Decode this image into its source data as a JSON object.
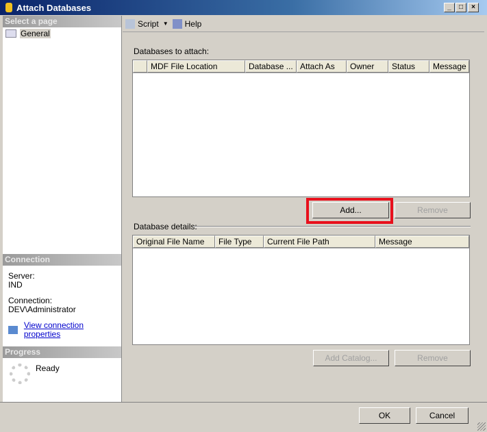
{
  "window": {
    "title": "Attach Databases"
  },
  "left": {
    "select_page": "Select a page",
    "pages": [
      "General"
    ],
    "connection_header": "Connection",
    "server_label": "Server:",
    "server": "IND",
    "connection_label": "Connection:",
    "connection": "DEV\\Administrator",
    "view_props": "View connection properties",
    "progress_header": "Progress",
    "progress_status": "Ready"
  },
  "toolbar": {
    "script": "Script",
    "help": "Help"
  },
  "attach": {
    "label": "Databases to attach:",
    "columns": [
      "",
      "MDF File Location",
      "Database ...",
      "Attach As",
      "Owner",
      "Status",
      "Message"
    ],
    "add": "Add...",
    "remove": "Remove"
  },
  "details": {
    "label": "Database details:",
    "columns": [
      "Original File Name",
      "File Type",
      "Current File Path",
      "Message"
    ],
    "add_catalog": "Add Catalog...",
    "remove": "Remove"
  },
  "footer": {
    "ok": "OK",
    "cancel": "Cancel"
  }
}
